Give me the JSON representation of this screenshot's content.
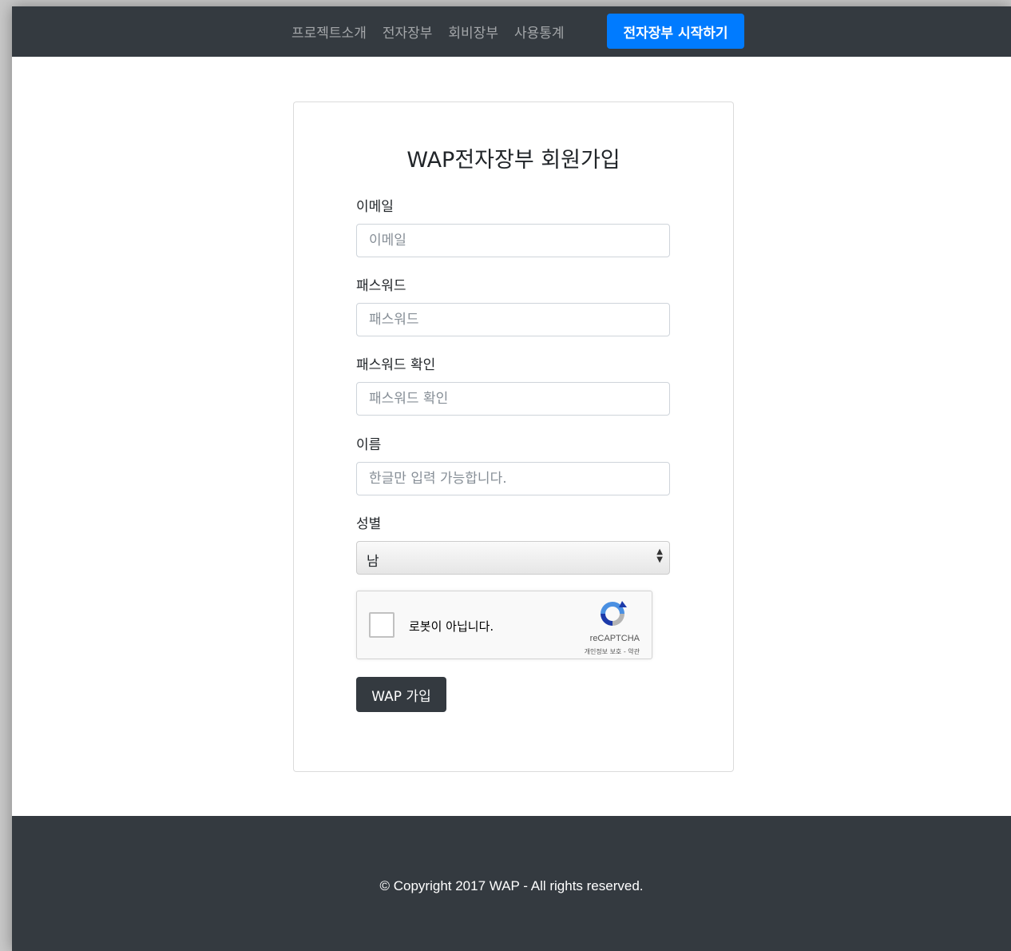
{
  "nav": {
    "links": [
      "프로젝트소개",
      "전자장부",
      "회비장부",
      "사용통계"
    ],
    "cta": "전자장부 시작하기"
  },
  "form": {
    "title": "WAP전자장부 회원가입",
    "email": {
      "label": "이메일",
      "placeholder": "이메일"
    },
    "password": {
      "label": "패스워드",
      "placeholder": "패스워드"
    },
    "password_confirm": {
      "label": "패스워드 확인",
      "placeholder": "패스워드 확인"
    },
    "name": {
      "label": "이름",
      "placeholder": "한글만 입력 가능합니다."
    },
    "gender": {
      "label": "성별",
      "value": "남"
    },
    "captcha": {
      "text": "로봇이 아닙니다.",
      "brand": "reCAPTCHA",
      "terms": "개인정보 보호 - 약관"
    },
    "submit": "WAP 가입"
  },
  "footer": {
    "copyright": "© Copyright 2017 WAP - All rights reserved."
  },
  "colors": {
    "navbar": "#343a40",
    "primary": "#007bff"
  }
}
